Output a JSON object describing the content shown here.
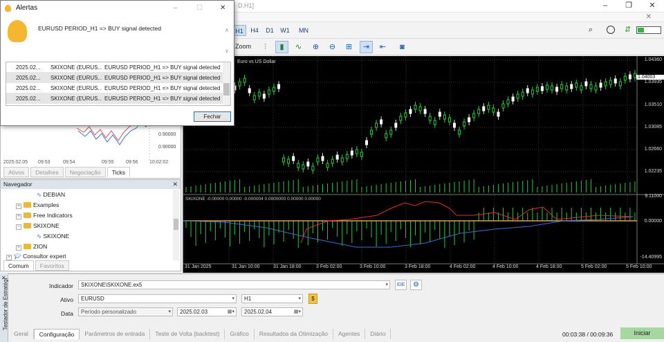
{
  "window": {
    "title_fragment": "D,H1]"
  },
  "toolbar": {
    "timeframes": [
      "H1",
      "H4",
      "D1",
      "W1",
      "MN"
    ],
    "active_timeframe": "H1",
    "zoom_label": "Zoom"
  },
  "chart": {
    "symbol_label": "Euro vs US Dollar",
    "indicator_label": "SKIXONE -0.00000 0.00000 -0.000004 0.0000000 0.00000 0.00000",
    "price_ticks": [
      "1.04360",
      "1.03935",
      "1.03510",
      "1.03085",
      "1.02660",
      "1.02235"
    ],
    "current_price": "1.04003",
    "indicator_ticks": [
      "9.11000",
      "0.00000",
      "-14.40995"
    ],
    "x_ticks": [
      "31 Jan 2025",
      "31 Jan 10:00",
      "31 Jan 18:00",
      "3 Feb 02:00",
      "3 Feb 10:00",
      "3 Feb 18:00",
      "4 Feb 02:00",
      "4 Feb 10:00",
      "4 Feb 18:00",
      "5 Feb 02:00",
      "5 Feb 10:00"
    ]
  },
  "alerts": {
    "title": "Alertas",
    "message": "EURUSD PERIOD_H1 => BUY signal detected",
    "rows": [
      {
        "date": "2025.02...",
        "source": "SKIXONE (EURUS...",
        "text": "EURUSD PERIOD_H1 => BUY signal detected"
      },
      {
        "date": "2025.02...",
        "source": "SKIXONE (EURUS...",
        "text": "EURUSD PERIOD_H1 => BUY signal detected"
      },
      {
        "date": "2025.02...",
        "source": "SKIXONE (EURUS...",
        "text": "EURUSD PERIOD_H1 => BUY signal detected"
      },
      {
        "date": "2025.02...",
        "source": "SKIXONE (EURUS...",
        "text": "EURUSD PERIOD_H1 => BUY signal detected"
      }
    ],
    "close_button": "Fechar"
  },
  "market_watch": {
    "prices": [
      "0.90000",
      "0.90000"
    ],
    "x_labels": [
      "2025.02.05",
      "09:53",
      "09:54",
      "09:55",
      "09:56",
      "10:02:02"
    ],
    "tabs": [
      "Ativos",
      "Detalhes",
      "Negociação",
      "Ticks"
    ],
    "active_tab": "Ticks"
  },
  "navigator": {
    "title": "Navegador",
    "items": [
      {
        "label": "DEBIAN",
        "type": "indicator"
      },
      {
        "label": "Examples",
        "type": "folder"
      },
      {
        "label": "Free Indicators",
        "type": "folder"
      },
      {
        "label": "SKIXONE",
        "type": "folder"
      },
      {
        "label": "SKIXONE",
        "type": "indicator"
      },
      {
        "label": "ZION",
        "type": "folder"
      },
      {
        "label": "Consultor expert",
        "type": "root"
      }
    ],
    "tabs": [
      "Comum",
      "Favoritos"
    ],
    "active_tab": "Comum"
  },
  "tester": {
    "side_title": "Testador de Estratégi",
    "indicator_label": "Indicador",
    "indicator_value": "SKIXONE\\SKIXONE.ex5",
    "ide_label": "IDE",
    "asset_label": "Ativo",
    "asset_value": "EURUSD",
    "period_value": "H1",
    "date_label": "Data",
    "date_mode": "Período personalizado",
    "date_from": "2025.02.03",
    "date_to": "2025.02.04",
    "tabs": [
      "Geral",
      "Configuração",
      "Parâmetros de entrada",
      "Teste de Volta (backtest)",
      "Gráfico",
      "Resultados da Otimização",
      "Agentes",
      "Diário"
    ],
    "active_tab": "Configuração",
    "timer": "00:03:38 / 00:09:36",
    "start_button": "Iniciar"
  }
}
